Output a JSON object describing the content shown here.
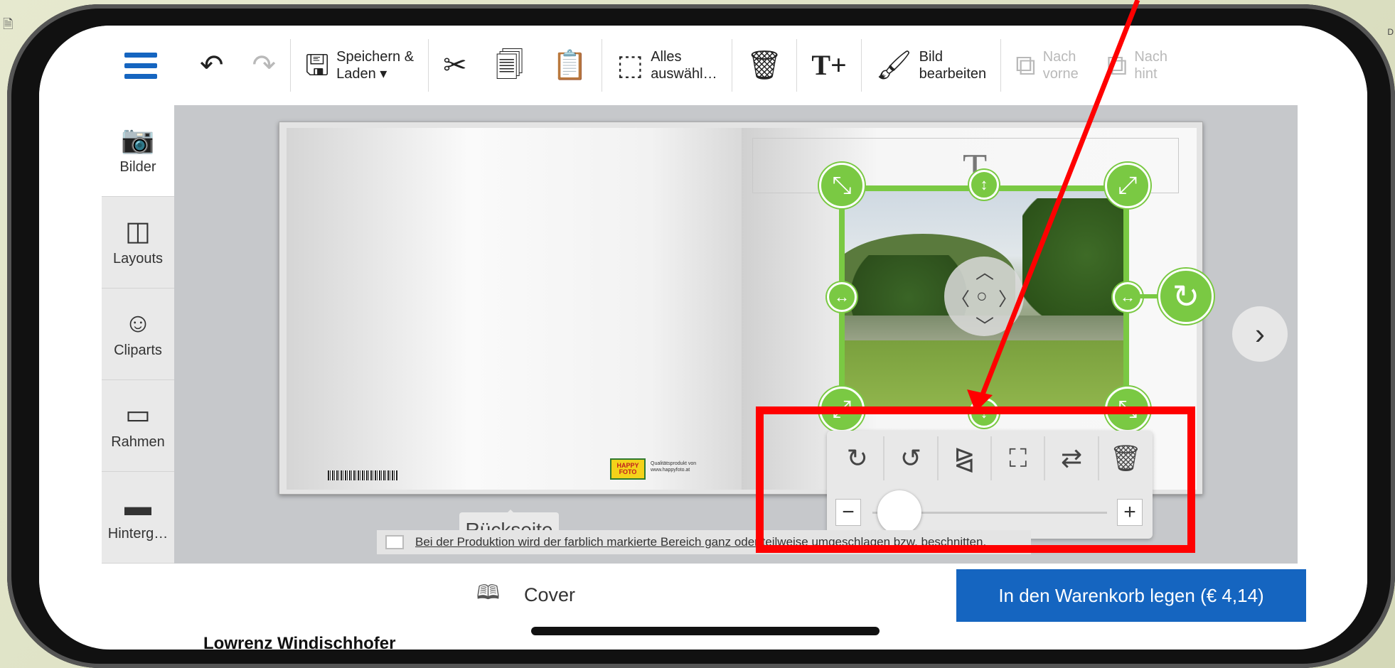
{
  "slide": {
    "corner_text": "D",
    "caption": "Lowrenz Windischhofer"
  },
  "toolbar": {
    "save_label": "Speichern &\nLaden ▾",
    "select_all_label": "Alles\nauswähl…",
    "edit_image_label": "Bild\nbearbeiten",
    "bring_forward_label": "Nach\nvorne",
    "send_back_label": "Nach\nhint"
  },
  "sidebar": {
    "items": [
      {
        "label": "Bilder",
        "icon": "camera-icon"
      },
      {
        "label": "Layouts",
        "icon": "layout-icon"
      },
      {
        "label": "Cliparts",
        "icon": "smiley-icon"
      },
      {
        "label": "Rahmen",
        "icon": "frame-icon"
      },
      {
        "label": "Hinterg…",
        "icon": "background-icon"
      }
    ]
  },
  "canvas": {
    "title_placeholder": "T",
    "brand_logo_text": "HAPPY\nFOTO",
    "brand_caption": "Qualitätsprodukt von\nwww.happyfoto.at",
    "page_tab_label": "Rückseite",
    "notice": "Bei der Produktion wird der farblich markierte Bereich ganz oder teilweise umgeschlagen bzw. beschnitten."
  },
  "bottom": {
    "cover_label": "Cover",
    "cart_label": "In den Warenkorb legen (€ 4,14)"
  },
  "colors": {
    "accent": "#1565c0",
    "selection": "#7ac943",
    "annotation": "#ff0000"
  },
  "zoom": {
    "level_fraction": 0.05
  }
}
